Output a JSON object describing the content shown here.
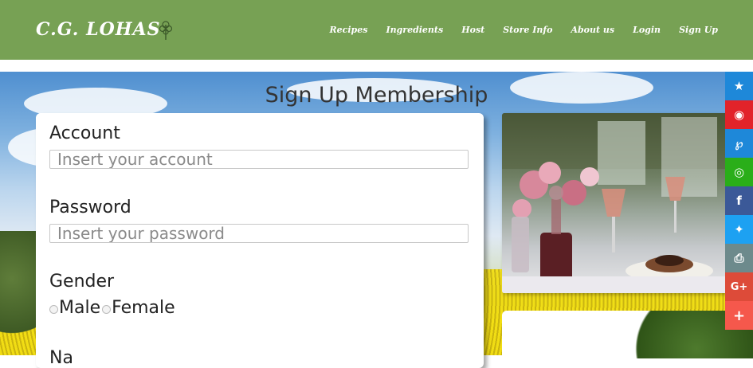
{
  "header": {
    "logo": "C.G. LOHAS",
    "nav": [
      "Recipes",
      "Ingredients",
      "Host",
      "Store Info",
      "About us",
      "Login",
      "Sign Up"
    ]
  },
  "page": {
    "title": "Sign Up Membership"
  },
  "form": {
    "account_label": "Account",
    "account_placeholder": "Insert your account",
    "password_label": "Password",
    "password_placeholder": "Insert your password",
    "gender_label": "Gender",
    "gender_options": [
      "Male",
      "Female"
    ],
    "name_label": "Na"
  },
  "share": {
    "buttons": [
      {
        "icon": "favorite-star-icon",
        "color": "#1e88d9",
        "glyph": "★"
      },
      {
        "icon": "weibo-icon",
        "color": "#e2232a",
        "glyph": "◉"
      },
      {
        "icon": "plurk-icon",
        "color": "#1e88d9",
        "glyph": "℘"
      },
      {
        "icon": "wechat-icon",
        "color": "#2aae19",
        "glyph": "◎"
      },
      {
        "icon": "facebook-icon",
        "color": "#3b5998",
        "glyph": "f"
      },
      {
        "icon": "twitter-icon",
        "color": "#1da1f2",
        "glyph": "✦"
      },
      {
        "icon": "print-icon",
        "color": "#6d8a8c",
        "glyph": "⎙"
      },
      {
        "icon": "google-plus-icon",
        "color": "#dd4b39",
        "glyph": "G+"
      },
      {
        "icon": "more-plus-icon",
        "color": "#f5584c",
        "glyph": "+"
      }
    ]
  },
  "colors": {
    "header_bg": "#77a154"
  }
}
